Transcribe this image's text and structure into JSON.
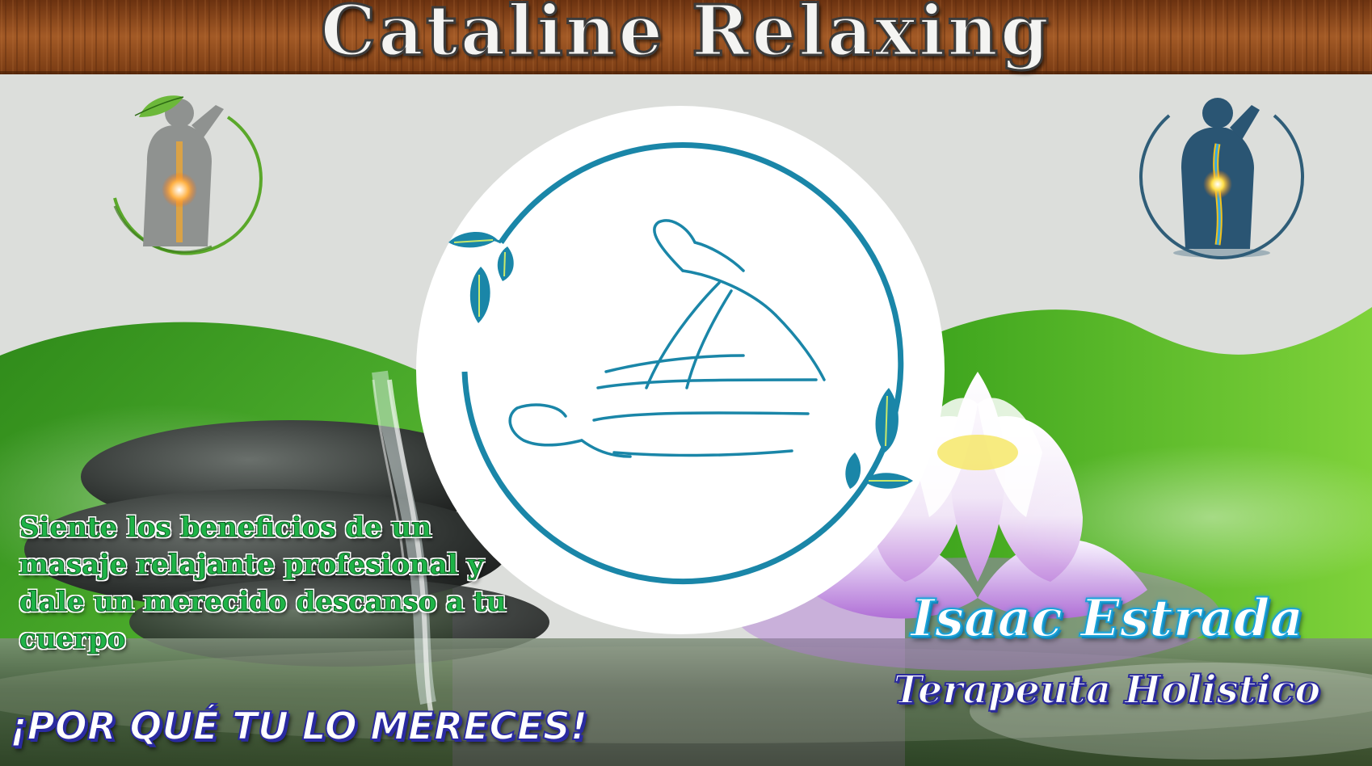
{
  "banner": {
    "title": "Cataline Relaxing"
  },
  "promo": {
    "lines": "Siente los beneficios de un masaje relajante profesional y dale un merecido descanso a tu cuerpo",
    "slogan": "¡POR QUÉ TU LO MERECES!"
  },
  "therapist": {
    "name": "Isaac Estrada",
    "role": "Terapeuta Holistico"
  },
  "colors": {
    "banner_wood": "#8a4a1f",
    "logo_teal": "#1a86a8",
    "leaf_green": "#5aa83a",
    "promo_green": "#1eb347",
    "slogan_blue": "#2a2aa0",
    "name_cyan": "#1aa3d9"
  },
  "icons": [
    "spine-icon-green",
    "spine-icon-blue",
    "massage-logo",
    "lotus-flower",
    "water-stream",
    "spa-stones"
  ]
}
